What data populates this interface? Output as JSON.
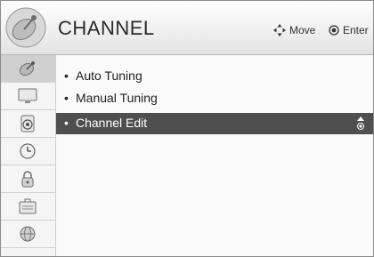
{
  "header": {
    "title": "CHANNEL",
    "move_hint": "Move",
    "enter_hint": "Enter",
    "logo_icon": "satellite-dish-logo"
  },
  "sidebar": {
    "items": [
      {
        "icon": "satellite-icon",
        "active": true
      },
      {
        "icon": "tv-picture-icon",
        "active": false
      },
      {
        "icon": "speaker-icon",
        "active": false
      },
      {
        "icon": "clock-icon",
        "active": false
      },
      {
        "icon": "lock-icon",
        "active": false
      },
      {
        "icon": "briefcase-options-icon",
        "active": false
      },
      {
        "icon": "globe-network-icon",
        "active": false
      }
    ]
  },
  "menu": {
    "bullet": "•",
    "items": [
      {
        "label": "Auto Tuning"
      },
      {
        "label": "Manual Tuning"
      },
      {
        "label": "Channel Edit",
        "selected": true
      }
    ]
  },
  "colors": {
    "selected_bg": "#4f4f4f",
    "selected_text": "#ffffff",
    "sidebar_active": "#cfcfcf"
  }
}
